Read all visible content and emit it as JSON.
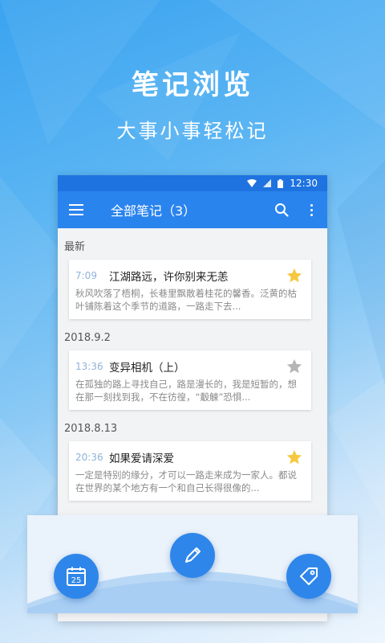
{
  "hero": {
    "title": "笔记浏览",
    "subtitle": "大事小事轻松记"
  },
  "status_bar": {
    "time": "12:30",
    "icons": [
      "wifi-icon",
      "signal-icon",
      "battery-icon"
    ]
  },
  "app_bar": {
    "title": "全部笔记（3）",
    "icons": [
      "menu-icon",
      "search-icon",
      "more-vert-icon"
    ]
  },
  "groups": [
    {
      "date": "最新",
      "notes": [
        {
          "time": "7:09",
          "title": "江湖路远，许你别来无恙",
          "body": "秋风吹落了梧桐，长巷里飘散着桂花的馨香。泛黄的枯叶铺陈着这个季节的道路，一路走下去...",
          "starred": true
        }
      ]
    },
    {
      "date": "2018.9.2",
      "notes": [
        {
          "time": "13:36",
          "title": "变异相机（上）",
          "body": "在孤独的路上寻找自己，路是漫长的，我是短暂的，想在那一刻找到我，不在彷徨，“觳觫”恐惧...",
          "starred": false
        }
      ]
    },
    {
      "date": "2018.8.13",
      "notes": [
        {
          "time": "20:36",
          "title": "如果爱请深爱",
          "body": "一定是特别的缘分，才可以一路走来成为一家人。都说在世界的某个地方有一个和自己长得很像的...",
          "starred": true
        }
      ]
    }
  ],
  "fabs": {
    "calendar_day": "25",
    "icons": [
      "calendar-icon",
      "pen-icon",
      "tag-icon"
    ]
  },
  "colors": {
    "primary": "#2a84ee",
    "status_bar": "#1e73e0",
    "star_active": "#f6c842",
    "star_inactive": "#b5b5b5",
    "fab": "#2f86ea"
  }
}
